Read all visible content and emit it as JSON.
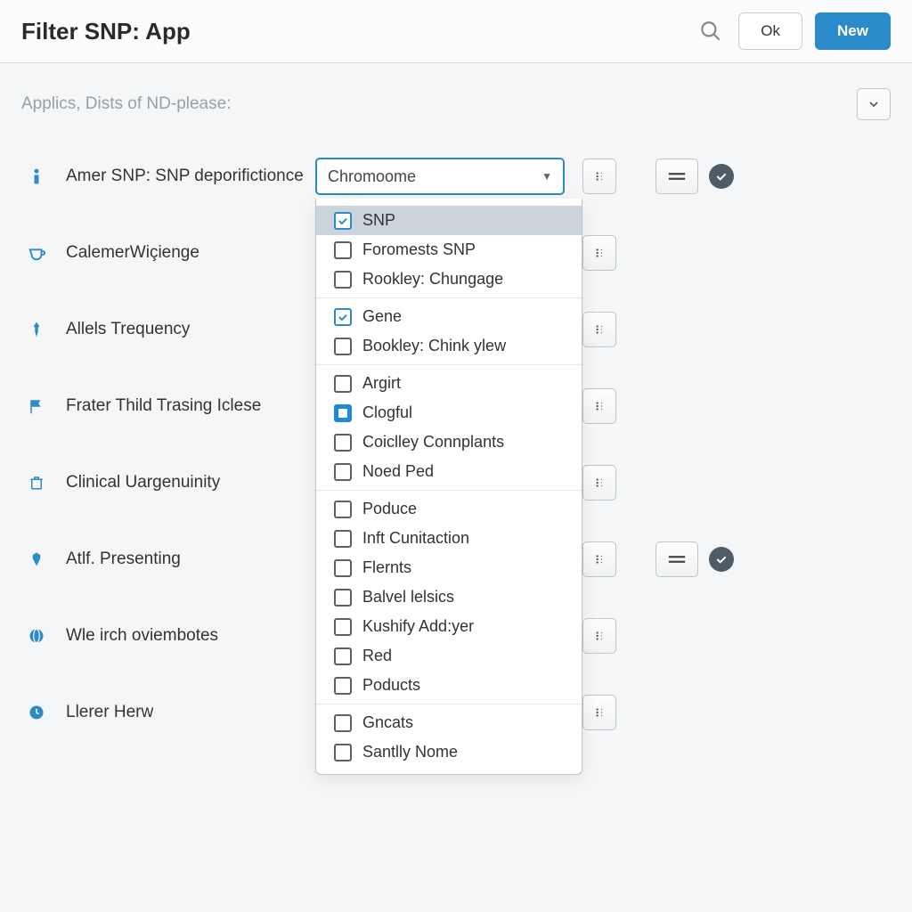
{
  "header": {
    "title": "Filter SNP: App",
    "ok_label": "Ok",
    "new_label": "New"
  },
  "subheader": {
    "text": "Applics, Dists of ND-please:"
  },
  "rows": [
    {
      "icon": "info",
      "label": "Amer SNP: SNP deporifictionce",
      "select_value": "Chromoome",
      "has_equals": true,
      "has_check": true
    },
    {
      "icon": "cup",
      "label": "CalemerWiçienge"
    },
    {
      "icon": "pin",
      "label": "Allels Trequency"
    },
    {
      "icon": "flag",
      "label": "Frater Thild Trasing Iclese"
    },
    {
      "icon": "trash",
      "label": "Clinical Uargenuinity"
    },
    {
      "icon": "tag",
      "label": "Atlf. Presenting",
      "has_equals": true,
      "has_check": true
    },
    {
      "icon": "globe",
      "label": "Wle irch oviembotes"
    },
    {
      "icon": "clock",
      "label": "Llerer Herw"
    }
  ],
  "dropdown": {
    "groups": [
      [
        {
          "label": "SNP",
          "state": "checked",
          "highlight": true
        },
        {
          "label": "Foromests SNP",
          "state": ""
        },
        {
          "label": "Rookley: Chungage",
          "state": ""
        }
      ],
      [
        {
          "label": "Gene",
          "state": "checked"
        },
        {
          "label": "Bookley: Chink ylew",
          "state": ""
        }
      ],
      [
        {
          "label": "Argirt",
          "state": ""
        },
        {
          "label": "Clogful",
          "state": "boxed"
        },
        {
          "label": "Coiclley Connplants",
          "state": ""
        },
        {
          "label": "Noed Ped",
          "state": ""
        }
      ],
      [
        {
          "label": "Poduce",
          "state": ""
        },
        {
          "label": "Inft Cunitaction",
          "state": ""
        },
        {
          "label": "Flernts",
          "state": ""
        },
        {
          "label": "Balvel lelsics",
          "state": ""
        },
        {
          "label": "Kushify Add:yer",
          "state": ""
        },
        {
          "label": "Red",
          "state": ""
        },
        {
          "label": "Poducts",
          "state": ""
        }
      ],
      [
        {
          "label": "Gncats",
          "state": ""
        },
        {
          "label": "Santlly Nome",
          "state": ""
        }
      ]
    ]
  }
}
